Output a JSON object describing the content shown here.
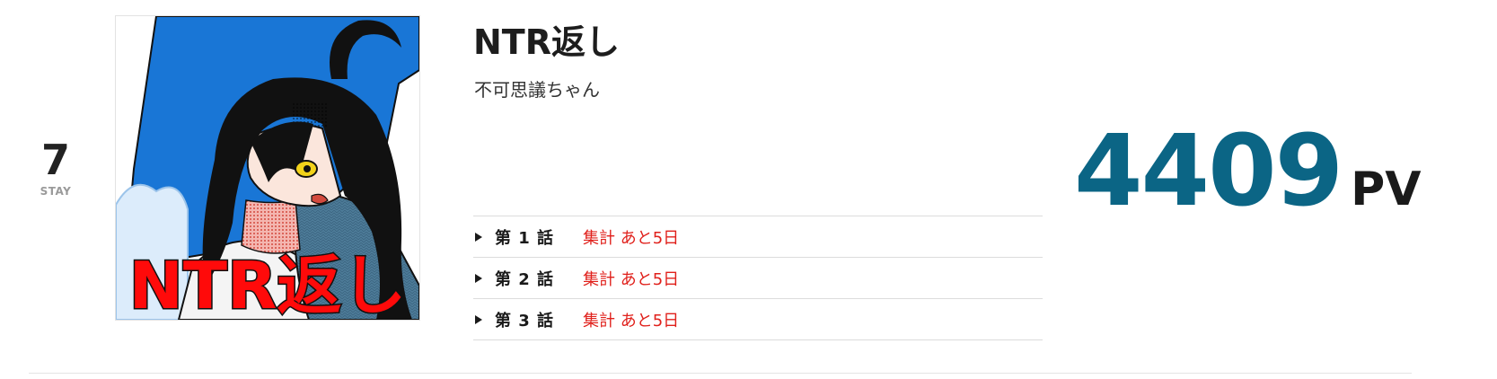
{
  "ranking_item": {
    "rank": "7",
    "rank_status": "STAY",
    "title": "NTR返し",
    "author": "不可思議ちゃん",
    "cover": {
      "overlay_text": "NTR返し",
      "colors": {
        "sky": "#1976d6",
        "hair": "#111111",
        "skin": "#fbe6dc",
        "eye": "#f2d21a",
        "sweater": "#4e7c99",
        "overlay_text": "#ff0a0a"
      }
    },
    "episodes": [
      {
        "label": "第 1 話",
        "status": "集計 あと5日"
      },
      {
        "label": "第 2 話",
        "status": "集計 あと5日"
      },
      {
        "label": "第 3 話",
        "status": "集計 あと5日"
      }
    ],
    "pv": {
      "value": "4409",
      "unit": "PV"
    }
  },
  "colors": {
    "pv_value": "#0b6585",
    "episode_status": "#e0201b",
    "rank_status": "#9a9a9a"
  }
}
